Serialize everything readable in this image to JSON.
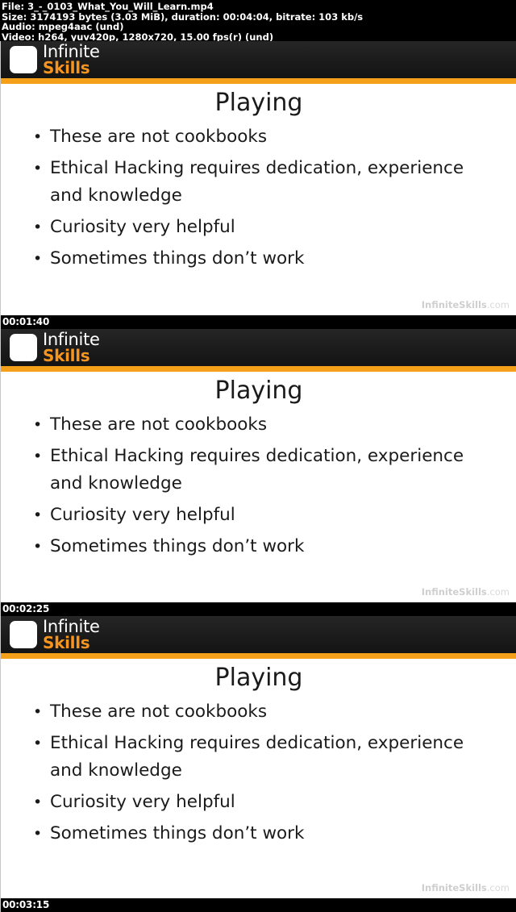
{
  "info_header": {
    "file_line": "File: 3_-_0103_What_You_Will_Learn.mp4",
    "size_line": "Size: 3174193 bytes (3.03 MiB), duration: 00:04:04, bitrate: 103 kb/s",
    "audio_line": "Audio: mpeg4aac (und)",
    "video_line": "Video: h264, yuv420p, 1280x720, 15.00 fps(r) (und)"
  },
  "brand": {
    "name_top": "Infinite",
    "name_bottom": "Skills",
    "accent_color": "#f7941e",
    "bar_color": "#f5a01b",
    "header_bg": "#1c1c1c"
  },
  "slide": {
    "title": "Playing",
    "bullets": [
      "These are not cookbooks",
      "Ethical Hacking requires dedication, experience and knowledge",
      "Curiosity very helpful",
      "Sometimes things don’t work"
    ],
    "watermark_bold": "InfiniteSkills",
    "watermark_rest": ".com"
  },
  "frames": [
    {
      "timestamp": "00:01:40"
    },
    {
      "timestamp": "00:02:25"
    },
    {
      "timestamp": "00:03:15"
    }
  ]
}
